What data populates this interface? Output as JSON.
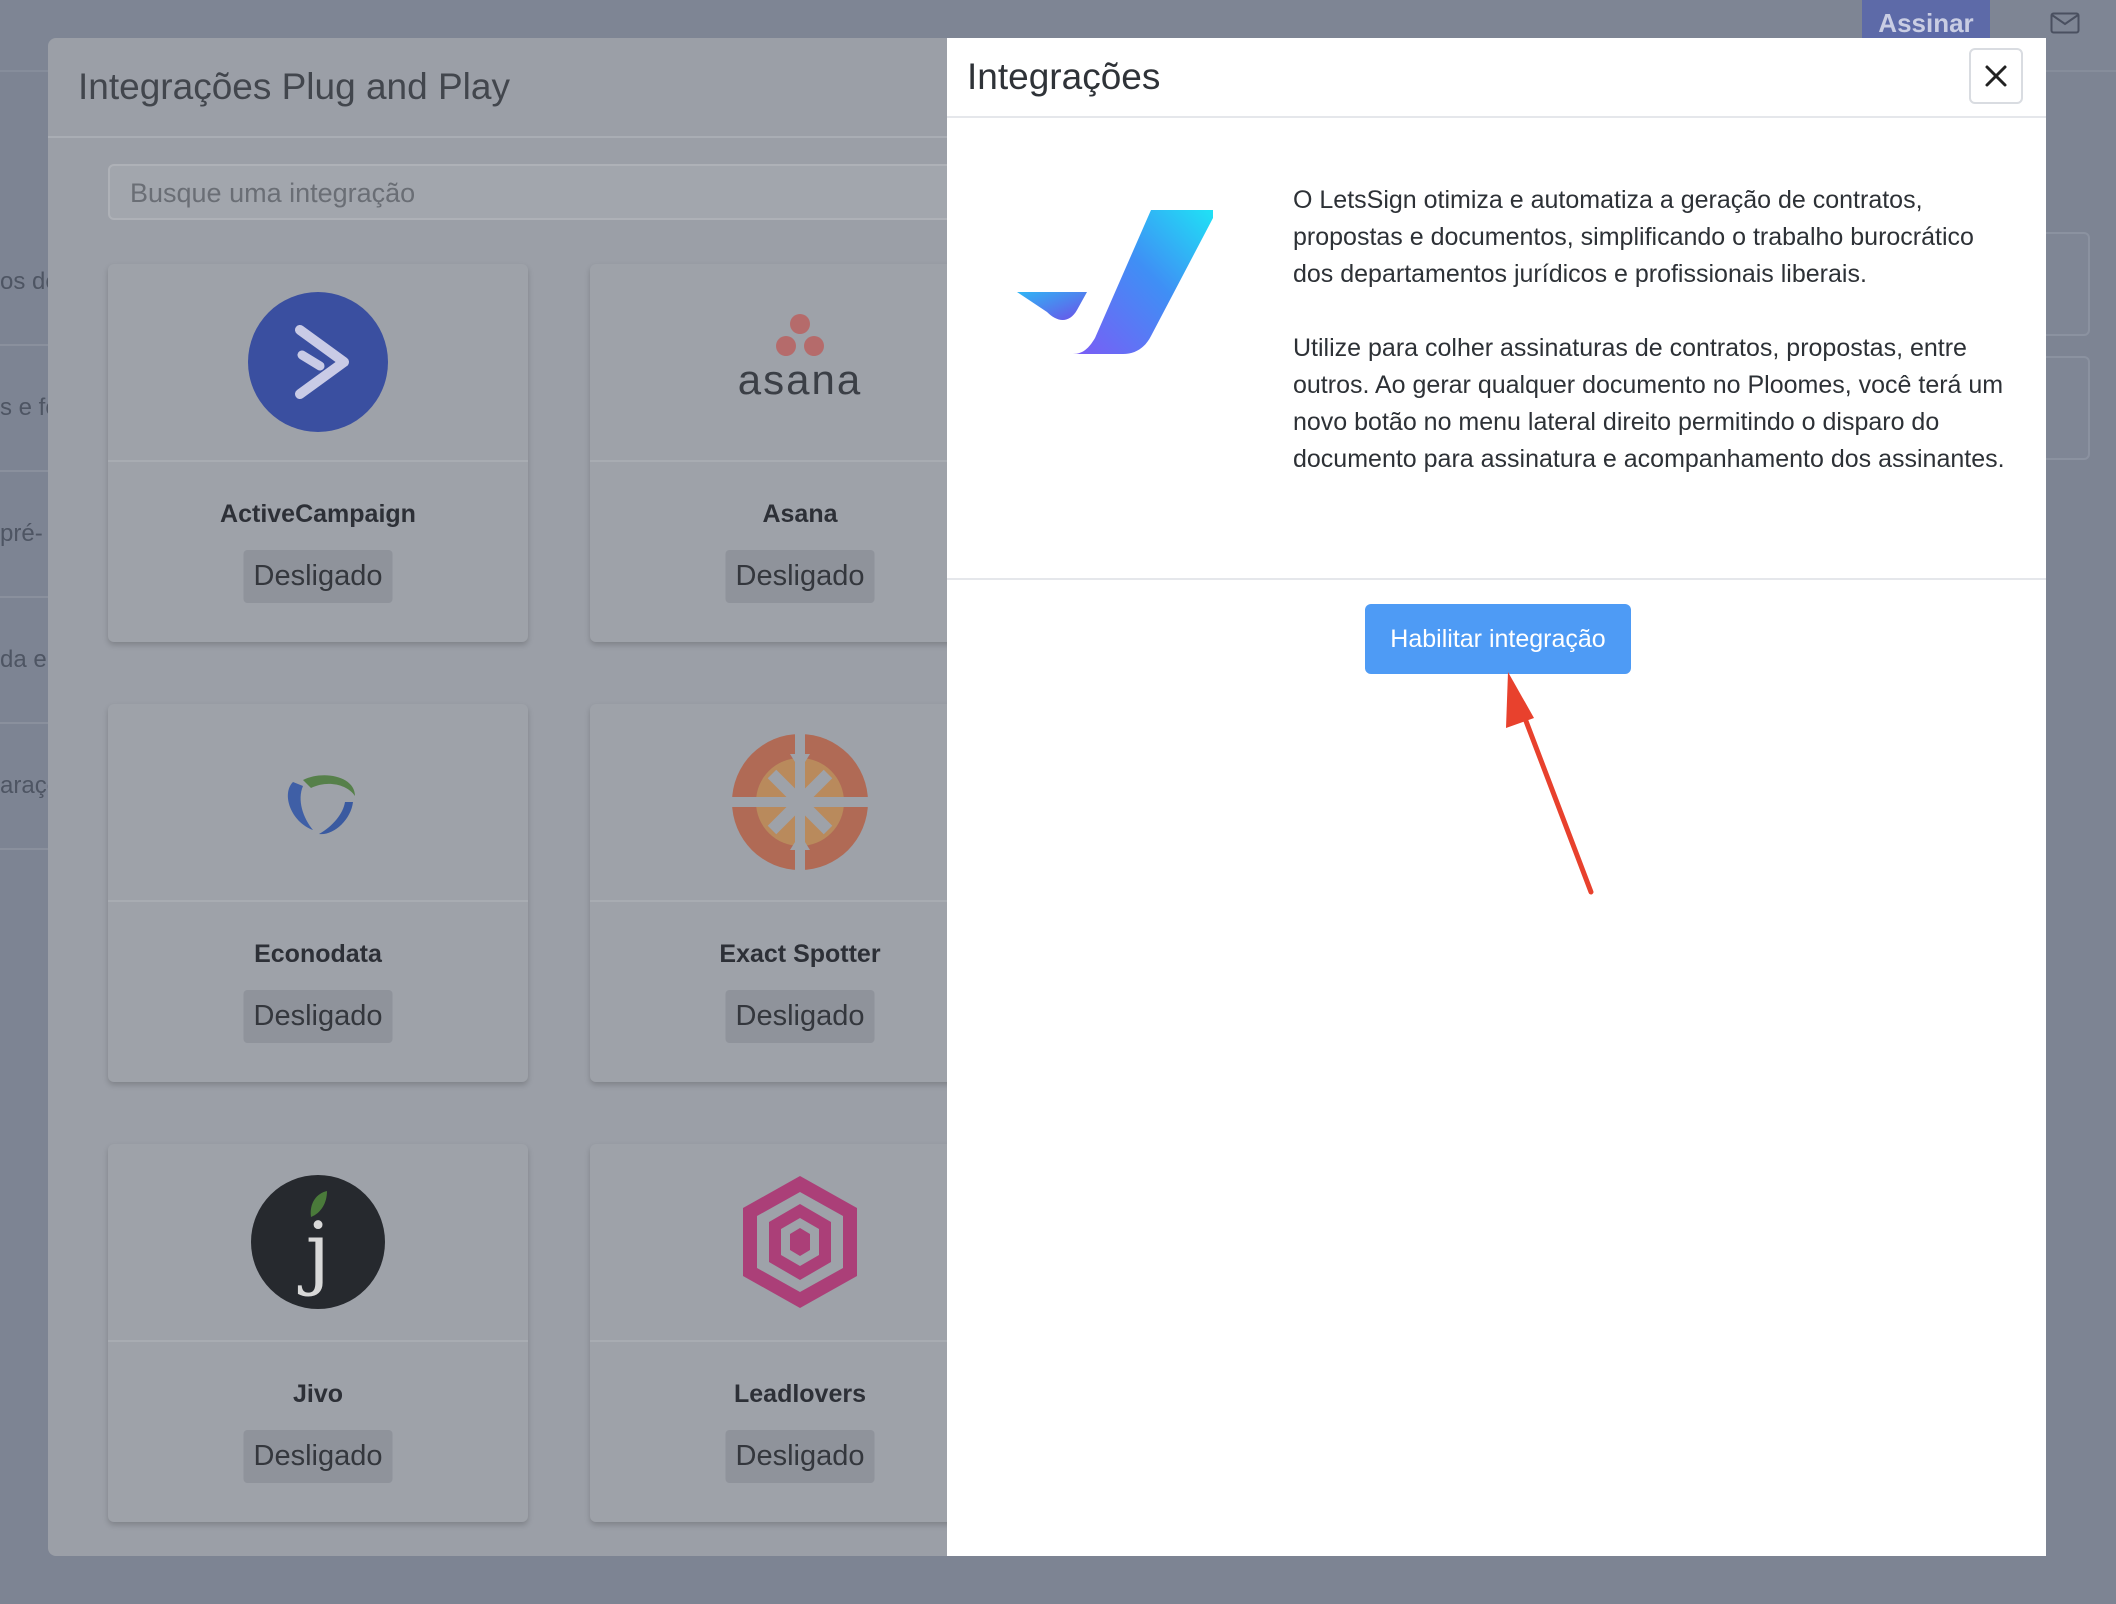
{
  "topbar": {
    "subscribe_label": "Assinar"
  },
  "background_sidebar": {
    "items": [
      "os do",
      "s e fo",
      "pré-",
      "da er",
      "araçõ"
    ]
  },
  "base_modal": {
    "title": "Integrações Plug and Play",
    "search": {
      "placeholder": "Busque uma integração"
    },
    "cards": [
      {
        "name": "ActiveCampaign",
        "status": "Desligado",
        "logo": "activecampaign-logo"
      },
      {
        "name": "Asana",
        "status": "Desligado",
        "logo": "asana-logo",
        "logo_text": "asana"
      },
      {
        "name": "Econodata",
        "status": "Desligado",
        "logo": "econodata-logo"
      },
      {
        "name": "Exact Spotter",
        "status": "Desligado",
        "logo": "exact-spotter-logo"
      },
      {
        "name": "Jivo",
        "status": "Desligado",
        "logo": "jivo-logo",
        "logo_text": "j"
      },
      {
        "name": "Leadlovers",
        "status": "Desligado",
        "logo": "leadlovers-logo"
      }
    ]
  },
  "detail_modal": {
    "title": "Integrações",
    "close_icon": "close-icon",
    "logo": "letssign-logo",
    "description": [
      "O LetsSign otimiza e automatiza a geração de contratos, propostas e documentos, simplificando o trabalho burocrático dos departamentos jurídicos e profissionais liberais.",
      "Utilize para colher assinaturas de contratos, propostas, entre outros. Ao gerar qualquer documento no Ploomes, você terá um novo botão no menu lateral direito permitindo o disparo do documento para assinatura e acompanhamento dos assinantes."
    ],
    "enable_button": "Habilitar integração"
  },
  "colors": {
    "primary_button": "#4e9bf5",
    "annotation_arrow": "#e8412d",
    "overlay": "#7d8493"
  }
}
